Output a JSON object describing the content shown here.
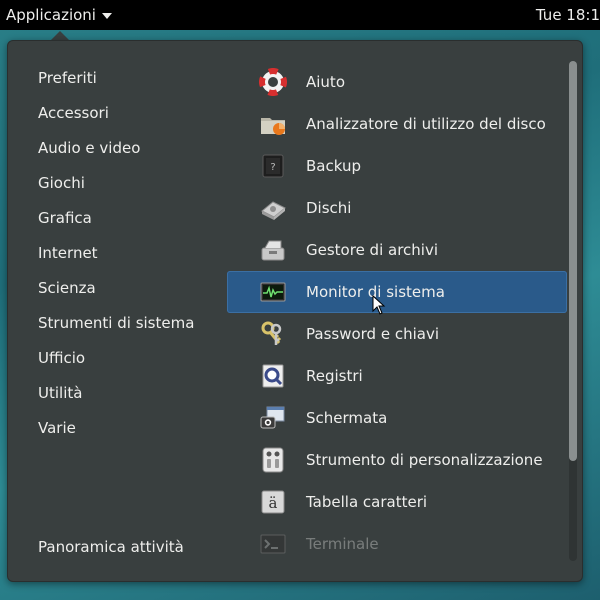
{
  "topbar": {
    "apps_menu_label": "Applicazioni",
    "clock": "Tue 18:1"
  },
  "categories": [
    "Preferiti",
    "Accessori",
    "Audio e video",
    "Giochi",
    "Grafica",
    "Internet",
    "Scienza",
    "Strumenti di sistema",
    "Ufficio",
    "Utilità",
    "Varie"
  ],
  "overview_label": "Panoramica attività",
  "apps": [
    {
      "label": "Aiuto",
      "icon": "lifebuoy-icon"
    },
    {
      "label": "Analizzatore di utilizzo del disco",
      "icon": "disk-usage-icon"
    },
    {
      "label": "Backup",
      "icon": "safe-icon"
    },
    {
      "label": "Dischi",
      "icon": "disks-icon"
    },
    {
      "label": "Gestore di archivi",
      "icon": "archive-icon"
    },
    {
      "label": "Monitor di sistema",
      "icon": "system-monitor-icon",
      "selected": true
    },
    {
      "label": "Password e chiavi",
      "icon": "keys-icon"
    },
    {
      "label": "Registri",
      "icon": "logs-icon"
    },
    {
      "label": "Schermata",
      "icon": "screenshot-icon"
    },
    {
      "label": "Strumento di personalizzazione",
      "icon": "tweak-tool-icon"
    },
    {
      "label": "Tabella caratteri",
      "icon": "character-map-icon"
    },
    {
      "label": "Terminale",
      "icon": "terminal-icon",
      "faded": true
    }
  ],
  "colors": {
    "selected_bg": "#2a5a8a",
    "panel_bg": "#393f3f",
    "topbar_bg": "#000000"
  }
}
